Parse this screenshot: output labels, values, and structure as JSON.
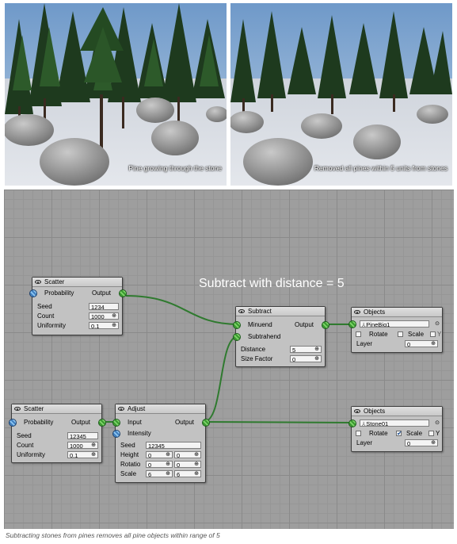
{
  "images": {
    "left_caption": "Pine growing through the stone",
    "right_caption": "Removed all pines within 5 units from stones"
  },
  "graph": {
    "headline": "Subtract with distance = 5",
    "wire_color": "#2f7a2f",
    "nodes": {
      "scatter1": {
        "title": "Scatter",
        "probability_label": "Probability",
        "output_label": "Output",
        "seed_label": "Seed",
        "seed_value": "1234",
        "count_label": "Count",
        "count_value": "1000",
        "uniformity_label": "Uniformity",
        "uniformity_value": "0.1"
      },
      "scatter2": {
        "title": "Scatter",
        "probability_label": "Probability",
        "output_label": "Output",
        "seed_label": "Seed",
        "seed_value": "12345",
        "count_label": "Count",
        "count_value": "1000",
        "uniformity_label": "Uniformity",
        "uniformity_value": "0.1"
      },
      "adjust": {
        "title": "Adjust",
        "input_label": "Input",
        "intensity_label": "Intensity",
        "output_label": "Output",
        "seed_label": "Seed",
        "seed_value": "12345",
        "height_label": "Height",
        "height_min": "0",
        "height_max": "0",
        "rotation_label": "Rotatio",
        "rotation_min": "0",
        "rotation_max": "0",
        "scale_label": "Scale",
        "scale_min": "6",
        "scale_max": "6"
      },
      "subtract": {
        "title": "Subtract",
        "minuend_label": "Minuend",
        "subtrahend_label": "Subtrahend",
        "output_label": "Output",
        "distance_label": "Distance",
        "distance_value": "5",
        "size_factor_label": "Size Factor",
        "size_factor_value": "0"
      },
      "objects1": {
        "title": "Objects",
        "object_name": "PineBig1",
        "rotate_label": "Rotate",
        "rotate_checked": false,
        "scale_label": "Scale",
        "scale_checked": false,
        "y_label": "Y",
        "y_checked": false,
        "layer_label": "Layer",
        "layer_value": "0"
      },
      "objects2": {
        "title": "Objects",
        "object_name": "Stone01",
        "rotate_label": "Rotate",
        "rotate_checked": true,
        "scale_label": "Scale",
        "scale_checked": false,
        "y_label": "Y",
        "y_checked": false,
        "layer_label": "Layer",
        "layer_value": "0"
      }
    }
  },
  "caption": "Subtracting stones from pines removes all pine objects within range of 5"
}
